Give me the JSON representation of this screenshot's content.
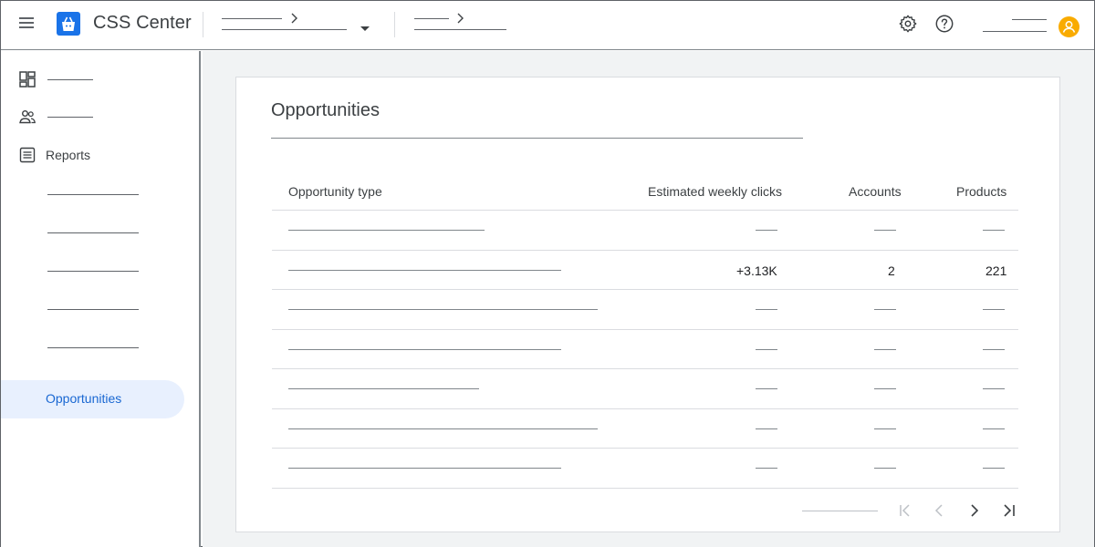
{
  "app": {
    "title": "CSS Center"
  },
  "icons": {
    "menu": "hamburger-menu-icon",
    "logo": "shopping-bag-logo",
    "settings": "gear-icon",
    "help": "help-icon",
    "account": "avatar-icon",
    "dashboard": "dashboard-icon",
    "accounts": "people-icon",
    "reports": "report-icon"
  },
  "colors": {
    "accent": "#1967d2",
    "active_bg": "#e8f0fe",
    "avatar": "#f9ab00",
    "logo": "#1a73e8"
  },
  "sidebar": {
    "reports_label": "Reports",
    "active_label": "Opportunities"
  },
  "main": {
    "card_title": "Opportunities",
    "table": {
      "columns": [
        "Opportunity type",
        "Estimated weekly clicks",
        "Accounts",
        "Products"
      ],
      "highlight_row": {
        "estimated_weekly_clicks": "+3.13K",
        "accounts": "2",
        "products": "221"
      }
    }
  }
}
